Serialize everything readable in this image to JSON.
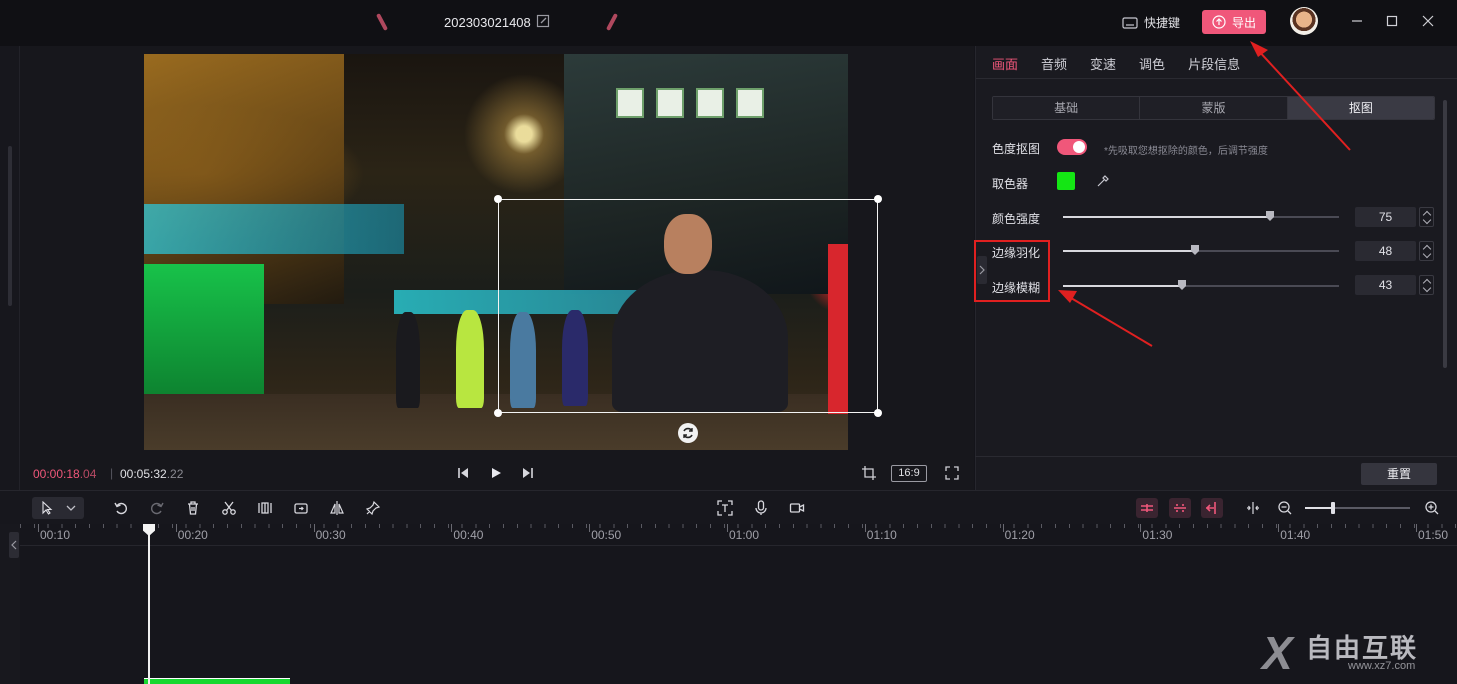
{
  "titlebar": {
    "title": "202303021408",
    "shortcut_label": "快捷键",
    "export_label": "导出"
  },
  "preview": {
    "time_current_main": "00:00:18",
    "time_current_frac": ".04",
    "time_sep": "|",
    "time_total_main": "00:05:32",
    "time_total_frac": ".22",
    "aspect_ratio": "16:9"
  },
  "panel": {
    "tabs": [
      {
        "label": "画面",
        "active": true
      },
      {
        "label": "音频",
        "active": false
      },
      {
        "label": "变速",
        "active": false
      },
      {
        "label": "调色",
        "active": false
      },
      {
        "label": "片段信息",
        "active": false
      }
    ],
    "subtabs": [
      {
        "label": "基础",
        "active": false
      },
      {
        "label": "蒙版",
        "active": false
      },
      {
        "label": "抠图",
        "active": true
      }
    ],
    "chroma_key_label": "色度抠图",
    "chroma_key_on": true,
    "chroma_hint": "*先吸取您想抠除的颜色，后调节强度",
    "picker_label": "取色器",
    "picker_color": "#14e614",
    "sliders": [
      {
        "label": "颜色强度",
        "value": "75",
        "fraction": 0.75
      },
      {
        "label": "边缘羽化",
        "value": "48",
        "fraction": 0.48
      },
      {
        "label": "边缘模糊",
        "value": "43",
        "fraction": 0.43
      }
    ],
    "reset_label": "重置"
  },
  "timeline": {
    "ticks": [
      "00:10",
      "00:20",
      "00:30",
      "00:40",
      "00:50",
      "01:00",
      "01:10",
      "01:20",
      "01:30",
      "01:40",
      "01:50"
    ],
    "zoom_fraction": 0.27
  },
  "watermark": {
    "brand": "自由互联",
    "url": "www.xz7.com"
  },
  "colors": {
    "accent": "#f0577a",
    "annotation_red": "#e02020",
    "panel_bg": "#1a1a20"
  }
}
